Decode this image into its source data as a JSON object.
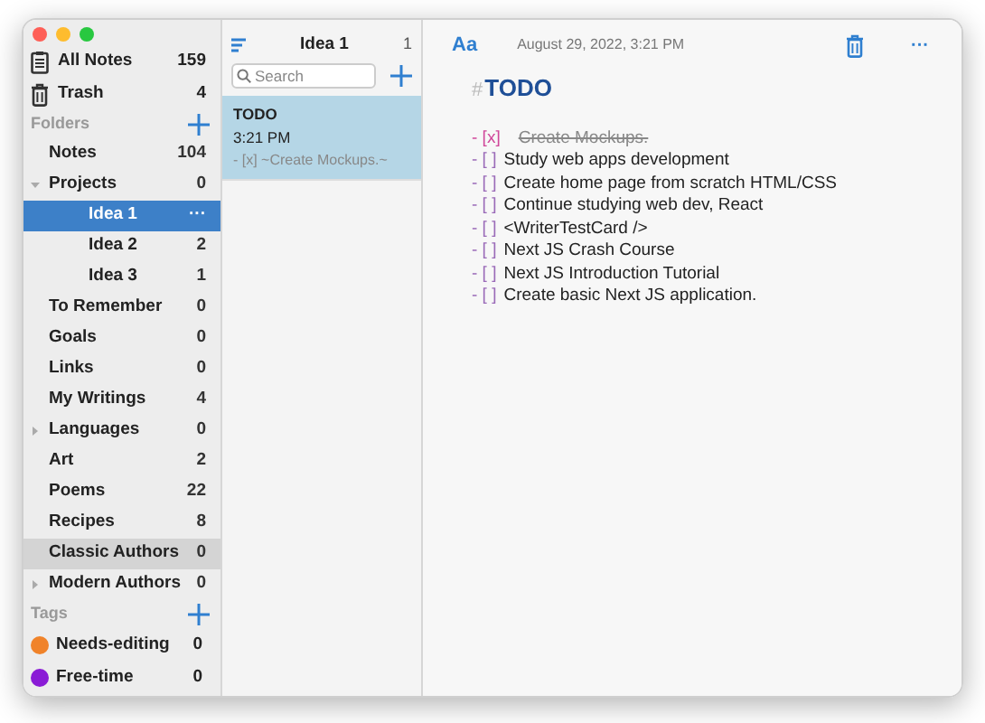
{
  "sidebar": {
    "top_items": [
      {
        "kind": "notes",
        "label": "All Notes",
        "count": "159"
      },
      {
        "kind": "trash",
        "label": "Trash",
        "count": "4"
      }
    ],
    "folders_header": "Folders",
    "folders": [
      {
        "label": "Notes",
        "count": "104",
        "selected": false,
        "highlighted": false
      },
      {
        "label": "Projects",
        "count": "0",
        "selected": false,
        "highlighted": false,
        "expanded": true,
        "children": [
          {
            "label": "Idea 1",
            "count": "···",
            "selected": true
          },
          {
            "label": "Idea 2",
            "count": "2",
            "selected": false,
            "highlighted": false
          },
          {
            "label": "Idea 3",
            "count": "1",
            "selected": false,
            "highlighted": false
          }
        ]
      },
      {
        "label": "To Remember",
        "count": "0",
        "selected": false,
        "highlighted": false
      },
      {
        "label": "Goals",
        "count": "0",
        "selected": false,
        "highlighted": false
      },
      {
        "label": "Links",
        "count": "0",
        "selected": false,
        "highlighted": false
      },
      {
        "label": "My Writings",
        "count": "4",
        "selected": false,
        "highlighted": false
      },
      {
        "label": "Languages",
        "count": "0",
        "selected": false,
        "highlighted": false,
        "expanded": false
      },
      {
        "label": "Art",
        "count": "2",
        "selected": false,
        "highlighted": false
      },
      {
        "label": "Poems",
        "count": "22",
        "selected": false,
        "highlighted": false
      },
      {
        "label": "Recipes",
        "count": "8",
        "selected": false,
        "highlighted": false
      },
      {
        "label": "Classic Authors",
        "count": "0",
        "selected": false,
        "highlighted": true
      },
      {
        "label": "Modern Authors",
        "count": "0",
        "selected": false,
        "highlighted": false,
        "expanded": false
      }
    ],
    "tags_header": "Tags",
    "tags": [
      {
        "label": "Needs-editing",
        "count": "0",
        "color": "#f0832a"
      },
      {
        "label": "Free-time",
        "count": "0",
        "color": "#8a1bd6"
      }
    ]
  },
  "note_list": {
    "title": "Idea 1",
    "count": "1",
    "search": {
      "placeholder": "Search"
    },
    "notes": [
      {
        "title": "TODO",
        "time": "3:21 PM",
        "preview": "- [x]  ~Create Mockups.~",
        "selected": true
      }
    ]
  },
  "editor": {
    "font_button": "Aa",
    "date": "August 29, 2022, 3:21 PM",
    "more": "···",
    "heading_mark": "#",
    "heading": "TODO",
    "tasks": [
      {
        "marker": "- [x]",
        "text": "Create Mockups.",
        "checked": true
      },
      {
        "marker": "- [ ]",
        "text": "Study web apps development",
        "checked": false
      },
      {
        "marker": "- [ ]",
        "text": "Create home page from scratch HTML/CSS",
        "checked": false
      },
      {
        "marker": "- [ ]",
        "text": "Continue studying web dev, React",
        "checked": false
      },
      {
        "marker": "- [ ]",
        "text": "<WriterTestCard />",
        "checked": false
      },
      {
        "marker": "- [ ]",
        "text": "Next JS Crash Course",
        "checked": false
      },
      {
        "marker": "- [ ]",
        "text": "Next JS Introduction Tutorial",
        "checked": false
      },
      {
        "marker": "- [ ]",
        "text": "Create basic Next JS application.",
        "checked": false
      }
    ]
  }
}
